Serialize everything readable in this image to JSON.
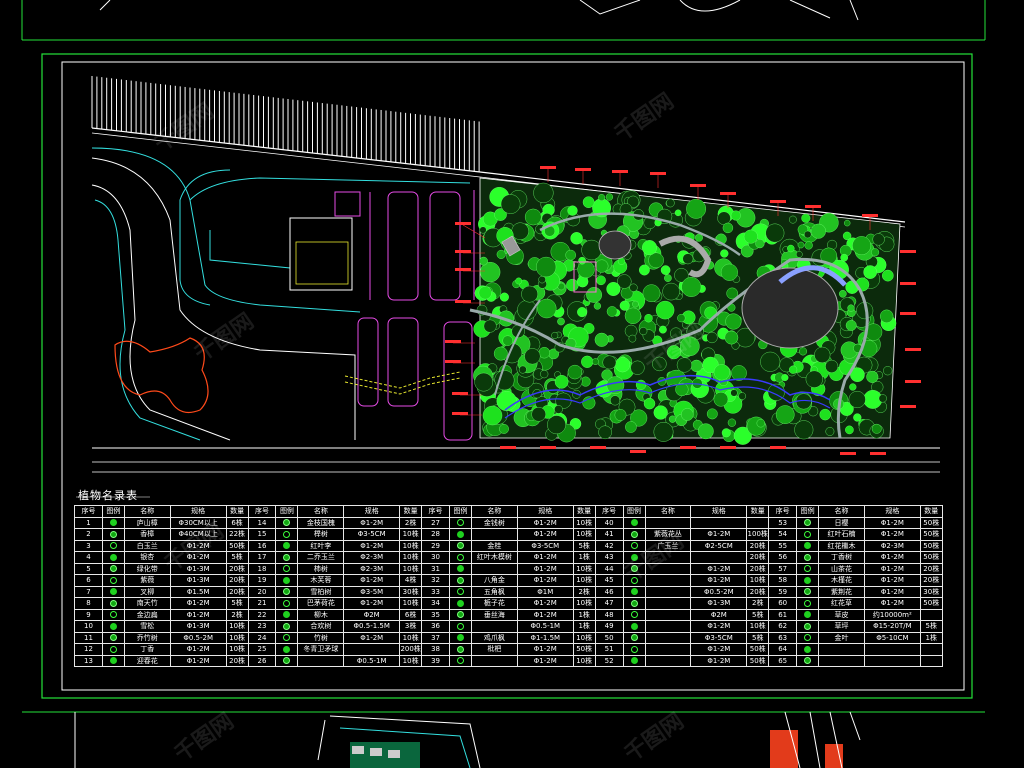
{
  "table_title": "植物名录表",
  "watermark_text": "千图网",
  "area_note": "约10000m²",
  "columns": [
    "序号",
    "图例",
    "名称",
    "规格",
    "数量"
  ],
  "colors": {
    "background": "#000000",
    "frame": "#25e23a",
    "road": "#33dede",
    "building": "#e64be6",
    "tree_fill": "#1ee11e",
    "path_blue": "#3a3aff",
    "label_red": "#ff3030",
    "table_line": "#e8e8e8",
    "pond": "#ff4a1a"
  },
  "rows": [
    [
      [
        "1",
        "庐山樟",
        "Φ30CM以上",
        "6株"
      ],
      [
        "14",
        "金枝国槐",
        "Φ1-2M",
        "2株"
      ],
      [
        "27",
        "金钱树",
        "Φ1-2M",
        "10株"
      ],
      [
        "40",
        "",
        "",
        "",
        ""
      ],
      [
        "53",
        "日樱",
        "Φ1-2M",
        "50株"
      ]
    ],
    [
      [
        "2",
        "香樟",
        "Φ40CM以上",
        "22株"
      ],
      [
        "15",
        "榉树",
        "Φ3-5CM",
        "10株"
      ],
      [
        "28",
        "",
        "Φ1-2M",
        "10株"
      ],
      [
        "41",
        "紫薇花丛",
        "Φ1-2M",
        "100株"
      ],
      [
        "54",
        "红叶石楠",
        "Φ1-2M",
        "50株"
      ]
    ],
    [
      [
        "3",
        "白玉兰",
        "Φ1-2M",
        "50株"
      ],
      [
        "16",
        "红叶李",
        "Φ1-2M",
        "10株"
      ],
      [
        "29",
        "金桂",
        "Φ3-5CM",
        "5株"
      ],
      [
        "42",
        "广玉兰",
        "Φ2-5CM",
        "20株"
      ],
      [
        "55",
        "红花檵木",
        "Φ2-3M",
        "50株"
      ]
    ],
    [
      [
        "4",
        "银杏",
        "Φ1-2M",
        "5株"
      ],
      [
        "17",
        "二乔玉兰",
        "Φ2-3M",
        "10株"
      ],
      [
        "30",
        "红叶木模树",
        "Φ1-2M",
        "1株"
      ],
      [
        "43",
        "",
        "",
        "20株"
      ],
      [
        "56",
        "丁香树",
        "Φ1-2M",
        "50株"
      ]
    ],
    [
      [
        "5",
        "绿化带",
        "Φ1-3M",
        "20株"
      ],
      [
        "18",
        "柿树",
        "Φ2-3M",
        "10株"
      ],
      [
        "31",
        "",
        "Φ1-2M",
        "10株"
      ],
      [
        "44",
        "",
        "Φ1-2M",
        "20株"
      ],
      [
        "57",
        "山茶花",
        "Φ1-2M",
        "20株"
      ]
    ],
    [
      [
        "6",
        "紫薇",
        "Φ1-3M",
        "20株"
      ],
      [
        "19",
        "木芙蓉",
        "Φ1-2M",
        "4株"
      ],
      [
        "32",
        "八角金",
        "Φ1-2M",
        "10株"
      ],
      [
        "45",
        "",
        "Φ1-2M",
        "10株"
      ],
      [
        "58",
        "木槿花",
        "Φ1-2M",
        "20株"
      ]
    ],
    [
      [
        "7",
        "叉柳",
        "Φ1.5M",
        "20株"
      ],
      [
        "20",
        "雪柏树",
        "Φ3-5M",
        "30株"
      ],
      [
        "33",
        "五角枫",
        "Φ1M",
        "2株"
      ],
      [
        "46",
        "",
        "Φ0.5-2M",
        "20株"
      ],
      [
        "59",
        "紫荆花",
        "Φ1-2M",
        "30株"
      ]
    ],
    [
      [
        "8",
        "南天竹",
        "Φ1-2M",
        "5株"
      ],
      [
        "21",
        "巴茅荷花",
        "Φ1-2M",
        "10株"
      ],
      [
        "34",
        "栀子花",
        "Φ1-2M",
        "10株"
      ],
      [
        "47",
        "",
        "Φ1-3M",
        "2株"
      ],
      [
        "60",
        "红花草",
        "Φ1-2M",
        "50株"
      ]
    ],
    [
      [
        "9",
        "金边扁",
        "Φ1-2M",
        "2株"
      ],
      [
        "22",
        "柳木",
        "Φ2M",
        "6株"
      ],
      [
        "35",
        "垂丝海",
        "Φ1-2M",
        "1株"
      ],
      [
        "48",
        "",
        "Φ2M",
        "5株"
      ],
      [
        "61",
        "草皮",
        "约10000m²",
        ""
      ]
    ],
    [
      [
        "10",
        "雪松",
        "Φ1-3M",
        "10株"
      ],
      [
        "23",
        "合欢树",
        "Φ0.5-1.5M",
        "3株"
      ],
      [
        "36",
        "",
        "Φ0.5-1M",
        "1株"
      ],
      [
        "49",
        "",
        "Φ1-2M",
        "10株"
      ],
      [
        "62",
        "草坪",
        "Φ15-20T/M",
        "5株"
      ]
    ],
    [
      [
        "11",
        "乔竹树",
        "Φ0.5-2M",
        "10株"
      ],
      [
        "24",
        "竹树",
        "Φ1-2M",
        "10株"
      ],
      [
        "37",
        "鸡爪枫",
        "Φ1-1.5M",
        "10株"
      ],
      [
        "50",
        "",
        "Φ3-5CM",
        "5株"
      ],
      [
        "63",
        "金叶",
        "Φ5-10CM",
        "1株"
      ]
    ],
    [
      [
        "12",
        "丁香",
        "Φ1-2M",
        "10株"
      ],
      [
        "25",
        "冬青卫矛球",
        "",
        "200株"
      ],
      [
        "38",
        "枇杷",
        "Φ1-2M",
        "50株"
      ],
      [
        "51",
        "",
        "Φ1-2M",
        "50株"
      ],
      [
        "64",
        "",
        "",
        ""
      ]
    ],
    [
      [
        "13",
        "迎春花",
        "Φ1-2M",
        "20株"
      ],
      [
        "26",
        "",
        "Φ0.5-1M",
        "10株"
      ],
      [
        "39",
        "",
        "Φ1-2M",
        "10株"
      ],
      [
        "52",
        "",
        "Φ1-2M",
        "50株"
      ],
      [
        "65",
        "",
        "",
        ""
      ]
    ]
  ]
}
